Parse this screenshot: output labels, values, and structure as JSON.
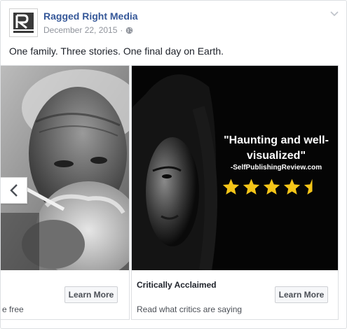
{
  "page": {
    "name": "Ragged Right Media",
    "date": "December 22, 2015",
    "separator": "·",
    "audience_icon": "globe-icon"
  },
  "post": {
    "text": "One family. Three stories. One final day on Earth."
  },
  "carousel": {
    "cards": [
      {
        "title": "",
        "description": "e free",
        "button_label": "Learn More"
      },
      {
        "title": "Critically Acclaimed",
        "description": "Read what critics are saying",
        "button_label": "Learn More",
        "quote": "\"Haunting and well-visualized\"",
        "attribution": "-SelfPublishingReview.com",
        "rating": 4.5,
        "rating_max": 5,
        "star_color": "#f5c518"
      }
    ],
    "prev_icon": "chevron-left-icon"
  },
  "colors": {
    "link": "#365899",
    "muted": "#90949c",
    "border": "#dddfe2"
  }
}
